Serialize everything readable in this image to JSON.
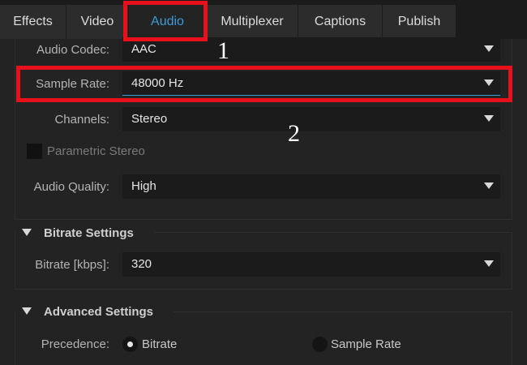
{
  "tabs": [
    {
      "label": "Effects"
    },
    {
      "label": "Video"
    },
    {
      "label": "Audio",
      "active": true
    },
    {
      "label": "Multiplexer"
    },
    {
      "label": "Captions"
    },
    {
      "label": "Publish"
    }
  ],
  "audio_settings": {
    "codec": {
      "label": "Audio Codec:",
      "value": "AAC"
    },
    "sample_rate": {
      "label": "Sample Rate:",
      "value": "48000 Hz"
    },
    "channels": {
      "label": "Channels:",
      "value": "Stereo"
    },
    "parametric_stereo": {
      "label": "Parametric Stereo",
      "checked": false,
      "enabled": false
    },
    "quality": {
      "label": "Audio Quality:",
      "value": "High"
    }
  },
  "bitrate_settings": {
    "title": "Bitrate Settings",
    "bitrate": {
      "label": "Bitrate [kbps]:",
      "value": "320"
    }
  },
  "advanced_settings": {
    "title": "Advanced Settings",
    "precedence": {
      "label": "Precedence:",
      "options": [
        {
          "label": "Bitrate",
          "selected": true
        },
        {
          "label": "Sample Rate",
          "selected": false
        }
      ]
    }
  },
  "annotations": {
    "marker_1": "1",
    "marker_2": "2",
    "highlight_color": "#e8101b"
  },
  "colors": {
    "accent": "#3d9bd9",
    "background": "#232323",
    "field": "#1b1b1b"
  }
}
